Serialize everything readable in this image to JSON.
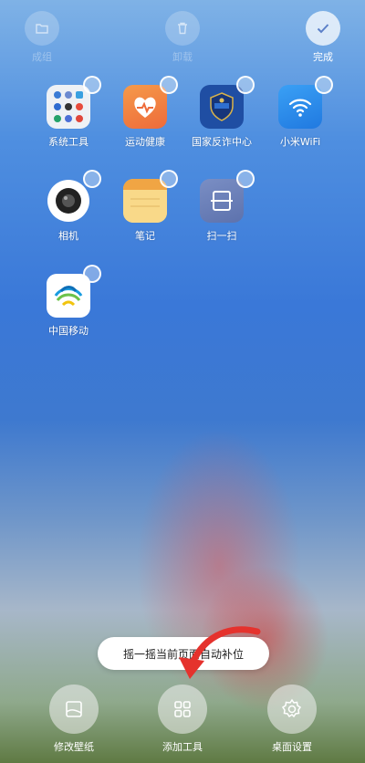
{
  "top_bar": {
    "folder_label": "成组",
    "uninstall_label": "卸载",
    "done_label": "完成"
  },
  "apps": [
    {
      "label": "系统工具",
      "icon": "system-tools-folder-icon"
    },
    {
      "label": "运动健康",
      "icon": "sport-health-icon"
    },
    {
      "label": "国家反诈中心",
      "icon": "anti-fraud-center-icon"
    },
    {
      "label": "小米WiFi",
      "icon": "wifi-icon"
    },
    {
      "label": "相机",
      "icon": "camera-icon"
    },
    {
      "label": "笔记",
      "icon": "notes-icon"
    },
    {
      "label": "扫一扫",
      "icon": "scan-icon"
    },
    {
      "label": "中国移动",
      "icon": "china-mobile-icon"
    }
  ],
  "toast": {
    "text": "摇一摇当前页面自动补位"
  },
  "bottom_bar": {
    "wallpaper_label": "修改壁纸",
    "add_tools_label": "添加工具",
    "desktop_settings_label": "桌面设置"
  },
  "colors": {
    "sport_health": "#f07a3a",
    "anti_fraud": "#1f4ea3",
    "wifi": "#2d8cf0",
    "notes": "#f7c86a",
    "scan": "#6b7fb8",
    "arrow": "#e5322d"
  }
}
